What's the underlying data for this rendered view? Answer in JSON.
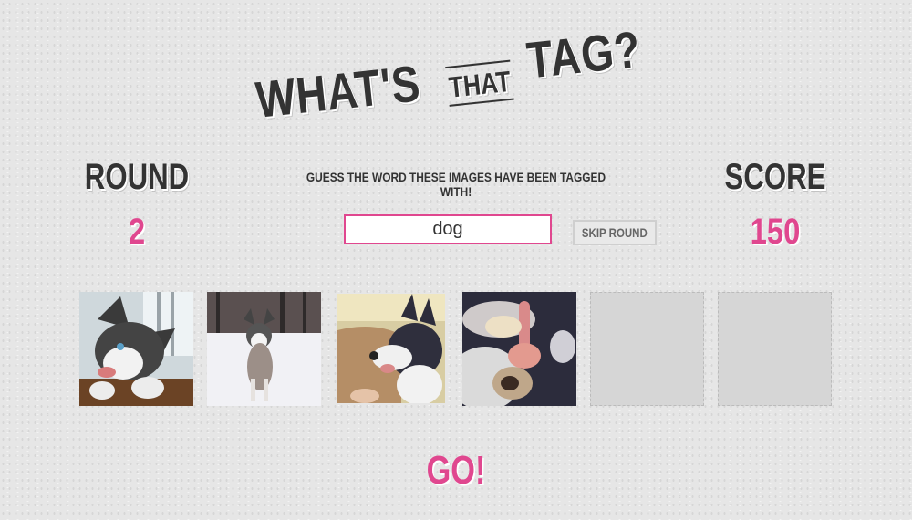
{
  "header": {
    "title_left": "WHAT'S",
    "title_mid": "THAT",
    "title_right": "TAG?"
  },
  "round": {
    "label": "ROUND",
    "value": "2"
  },
  "score": {
    "label": "SCORE",
    "value": "150"
  },
  "game": {
    "instructions": "GUESS THE WORD THESE IMAGES HAVE BEEN TAGGED WITH!",
    "guess_value": "dog",
    "skip_label": "SKIP ROUND",
    "go_label": "GO!"
  },
  "images": [
    {
      "state": "revealed",
      "subject": "husky puppy chewing"
    },
    {
      "state": "revealed",
      "subject": "husky in snow"
    },
    {
      "state": "revealed",
      "subject": "husky in car"
    },
    {
      "state": "revealed",
      "subject": "pug paw on hand"
    },
    {
      "state": "hidden"
    },
    {
      "state": "hidden"
    }
  ],
  "colors": {
    "accent": "#e0478f",
    "text": "#333333",
    "background": "#e6e6e6"
  }
}
